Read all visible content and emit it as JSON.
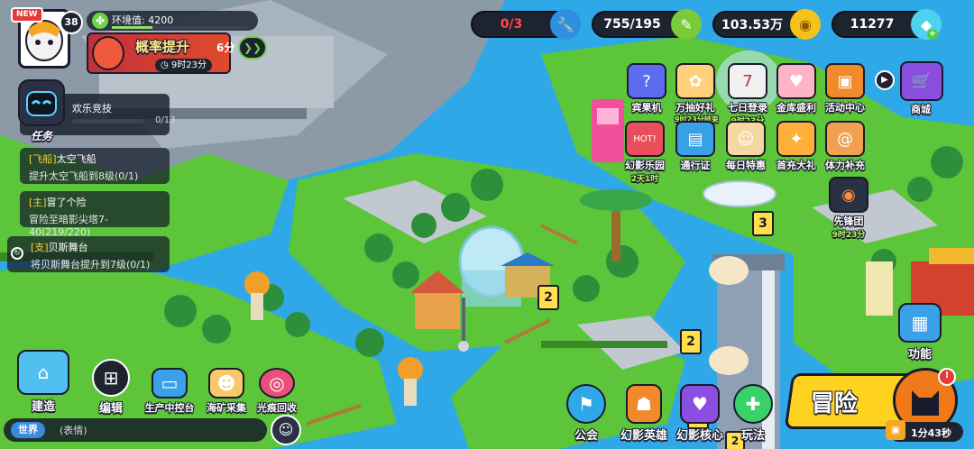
{
  "player": {
    "badge": "NEW",
    "level": "38",
    "env_label": "环境值: 4200",
    "env_progress": 0.3
  },
  "event_banner": {
    "title": "概率提升",
    "timer": "9时23分",
    "side_timer": "6分"
  },
  "resources": [
    {
      "value": "0/3",
      "icon": "wrench-icon",
      "color": "#2f8fe0"
    },
    {
      "value": "755/195",
      "icon": "pen-icon",
      "color": "#7acb3a"
    },
    {
      "value": "103.53万",
      "icon": "gold-coin-icon",
      "color": "#f5c21b"
    },
    {
      "value": "11277",
      "icon": "diamond-icon",
      "color": "#4fd2f0"
    }
  ],
  "task_panel": {
    "title": "任务",
    "event_name": "欢乐竞技",
    "event_progress": "0/13",
    "quests": [
      {
        "tag": "[飞船]",
        "title": "太空飞船",
        "desc": "提升太空飞船到8级(0/1)"
      },
      {
        "tag": "[主]",
        "title": "冒了个险",
        "desc": "冒险至暗影尖塔7-40(219/220)"
      },
      {
        "tag": "[支]",
        "title": "贝斯舞台",
        "desc": "将贝斯舞台提升到7级(0/1)"
      }
    ]
  },
  "feature_row1": [
    {
      "label": "宾果机",
      "timer": ""
    },
    {
      "label": "万抽好礼",
      "timer": "9时23分结束"
    },
    {
      "label": "七日登录",
      "timer": "9时23分"
    },
    {
      "label": "金库盛利",
      "timer": ""
    },
    {
      "label": "活动中心",
      "timer": ""
    },
    {
      "label": "商城",
      "timer": ""
    }
  ],
  "feature_row2": [
    {
      "label": "幻影乐园",
      "timer": "2天1时"
    },
    {
      "label": "通行证",
      "timer": ""
    },
    {
      "label": "每日特惠",
      "timer": ""
    },
    {
      "label": "首充大礼",
      "timer": ""
    },
    {
      "label": "体力补充",
      "timer": ""
    }
  ],
  "pioneer": {
    "label": "先锋团",
    "timer": "9时23分"
  },
  "function_button": {
    "label": "功能"
  },
  "bottom_left": [
    {
      "label": "建造"
    },
    {
      "label": "编辑"
    },
    {
      "label": "生产中控台"
    },
    {
      "label": "海矿采集"
    },
    {
      "label": "光痕回收"
    }
  ],
  "bottom_right": [
    {
      "label": "公会"
    },
    {
      "label": "幻影英雄"
    },
    {
      "label": "幻影核心"
    },
    {
      "label": "玩法"
    }
  ],
  "adventure": {
    "label": "冒险",
    "timer": "1分43秒"
  },
  "chat": {
    "channel": "世界",
    "placeholder": "(表情)"
  },
  "map_markers": [
    "2",
    "2",
    "3",
    "2",
    "2"
  ],
  "colors": {
    "water": "#2fa8e8",
    "grass": "#5cc53a",
    "adventure_yellow": "#ffd21f",
    "panel_dark": "#1e2330"
  }
}
